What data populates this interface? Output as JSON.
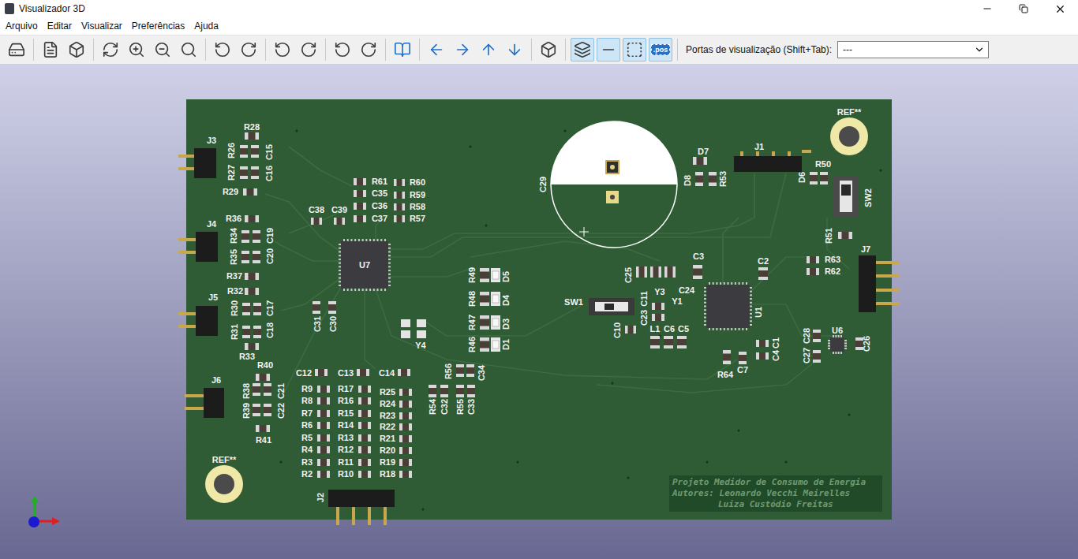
{
  "window": {
    "title": "Visualizador 3D"
  },
  "menu": [
    "Arquivo",
    "Editar",
    "Visualizar",
    "Preferências",
    "Ajuda"
  ],
  "toolbar": {
    "buttons": [
      {
        "selected": false
      },
      {
        "selected": false
      },
      {
        "selected": false
      },
      {
        "selected": false
      },
      {
        "selected": false
      },
      {
        "selected": false
      },
      {
        "selected": false
      },
      {
        "selected": false
      },
      {
        "selected": false
      },
      {
        "selected": false
      },
      {
        "selected": false
      },
      {
        "selected": false
      },
      {
        "selected": false
      },
      {
        "selected": false
      },
      {
        "selected": false
      },
      {
        "selected": false
      },
      {
        "selected": false
      },
      {
        "selected": false
      },
      {
        "selected": false
      },
      {
        "selected": true
      },
      {
        "selected": true
      },
      {
        "selected": true
      },
      {
        "selected": true,
        "text": ".pos"
      }
    ],
    "viewports": {
      "label": "Portas de visualização (Shift+Tab):",
      "value": "---"
    }
  },
  "board": {
    "parts": [
      "J3",
      "R28",
      "R26",
      "C15",
      "R27",
      "C16",
      "R29",
      "J4",
      "R36",
      "R34",
      "C19",
      "R35",
      "C20",
      "R37",
      "J5",
      "R32",
      "R30",
      "C17",
      "R31",
      "C18",
      "R33",
      "R40",
      "J6",
      "R38",
      "C21",
      "R39",
      "C22",
      "R41",
      "C38",
      "C39",
      "R61",
      "C35",
      "C36",
      "C37",
      "R60",
      "R59",
      "R58",
      "R57",
      "U7",
      "C31",
      "C30",
      "Y4",
      "C12",
      "C13",
      "C14",
      "R9",
      "R8",
      "R7",
      "R6",
      "R5",
      "R4",
      "R3",
      "R2",
      "R17",
      "R16",
      "R15",
      "R14",
      "R13",
      "R12",
      "R11",
      "R10",
      "R25",
      "R24",
      "R23",
      "R22",
      "R21",
      "R20",
      "R19",
      "R18",
      "R56",
      "C34",
      "R54",
      "C32",
      "R55",
      "C33",
      "R49",
      "D5",
      "R48",
      "D4",
      "R47",
      "D3",
      "R46",
      "D1",
      "J2",
      "C29",
      "D7",
      "D8",
      "R53",
      "J1",
      "D6",
      "R50",
      "SW2",
      "R51",
      "J7",
      "R63",
      "R62",
      "C3",
      "C2",
      "C25",
      "C24",
      "Y3",
      "Y1",
      "C11",
      "C23",
      "SW1",
      "C10",
      "L1",
      "C6",
      "C5",
      "U1",
      "R64",
      "C7",
      "C1",
      "C4",
      "C28",
      "C27",
      "U6",
      "C26"
    ],
    "holes": [
      {
        "label": "REF**"
      },
      {
        "label": "REF**"
      }
    ],
    "title_block": [
      "Projeto Medidor de Consumo de Energia",
      "Autores: Leonardo Vecchi Meirelles",
      "Luiza Custódio Freitas"
    ]
  }
}
